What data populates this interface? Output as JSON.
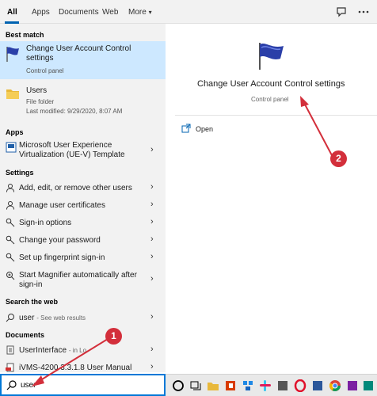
{
  "tabs": [
    "All",
    "Apps",
    "Documents",
    "Web",
    "More"
  ],
  "sections": {
    "best_match": "Best match",
    "apps": "Apps",
    "settings": "Settings",
    "search_web": "Search the web",
    "documents": "Documents"
  },
  "best_match": {
    "line1": "Change User Account Control",
    "line2": "settings",
    "sub": "Control panel"
  },
  "users_item": {
    "title": "Users",
    "type": "File folder",
    "modified": "Last modified: 9/29/2020, 8:07 AM"
  },
  "apps": [
    {
      "line1": "Microsoft User Experience",
      "line2": "Virtualization (UE-V) Template"
    }
  ],
  "settings": [
    {
      "label": "Add, edit, or remove other users"
    },
    {
      "label": "Manage user certificates"
    },
    {
      "label": "Sign-in options"
    },
    {
      "label": "Change your password"
    },
    {
      "label": "Set up fingerprint sign-in"
    },
    {
      "line1": "Start Magnifier automatically after",
      "line2": "sign-in"
    }
  ],
  "web": {
    "query": "user",
    "hint": "- See web results"
  },
  "documents": [
    {
      "title": "UserInterface",
      "hint": "- in Lo"
    },
    {
      "title": "iVMS-4200 3.3.1.8 User Manual"
    }
  ],
  "detail": {
    "title": "Change User Account Control settings",
    "sub": "Control panel",
    "open": "Open"
  },
  "search": {
    "value": "user"
  },
  "callouts": [
    "1",
    "2"
  ],
  "icons": [
    "search-icon",
    "feedback-icon",
    "ellipsis-icon",
    "flag-icon",
    "folder-icon",
    "gear-icon",
    "chevron-right-icon",
    "open-icon",
    "magnifier-icon",
    "document-icon",
    "pdf-icon"
  ],
  "colors": {
    "accent": "#0063b1",
    "selection": "#cde8ff",
    "callout": "#d32f3b"
  }
}
